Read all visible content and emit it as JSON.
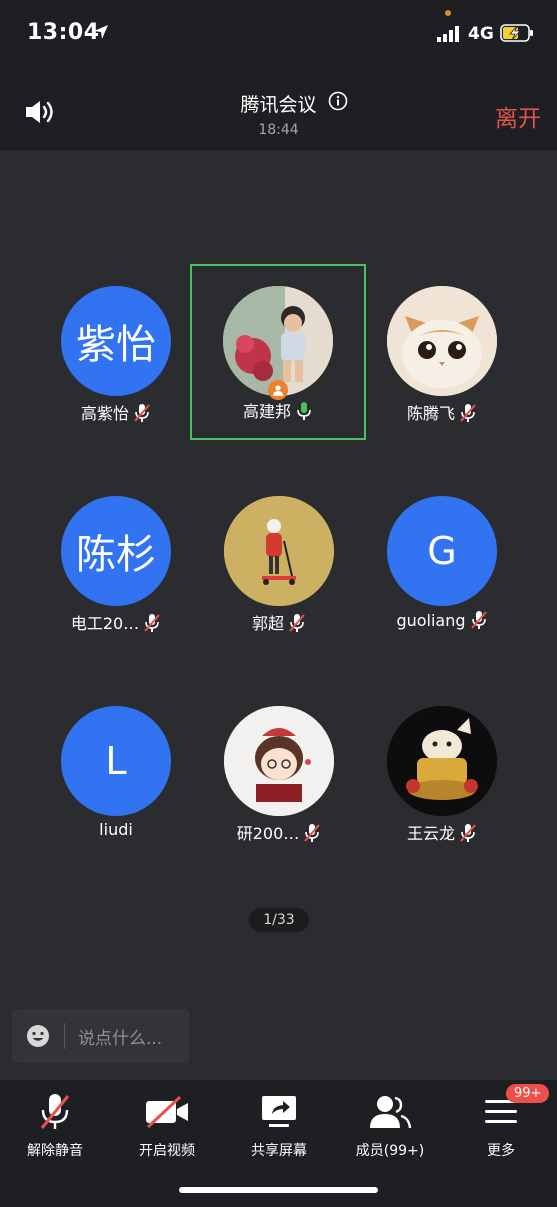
{
  "status_bar": {
    "time": "13:04",
    "network": "4G"
  },
  "header": {
    "title": "腾讯会议",
    "duration": "18:44",
    "leave_label": "离开"
  },
  "participants": [
    {
      "avatar_text": "紫怡",
      "name": "高紫怡",
      "mic": "muted"
    },
    {
      "avatar_text": "",
      "name": "高建邦",
      "mic": "active",
      "host": true,
      "avatar_image": "child-photo"
    },
    {
      "avatar_text": "",
      "name": "陈腾飞",
      "mic": "muted",
      "avatar_image": "cat-photo"
    },
    {
      "avatar_text": "陈杉",
      "name": "电工20…",
      "mic": "muted"
    },
    {
      "avatar_text": "",
      "name": "郭超",
      "mic": "muted",
      "avatar_image": "scooter-kid-photo"
    },
    {
      "avatar_text": "G",
      "name": "guoliang",
      "mic": "muted"
    },
    {
      "avatar_text": "L",
      "name": "liudi",
      "mic": "none"
    },
    {
      "avatar_text": "",
      "name": "研200…",
      "mic": "muted",
      "avatar_image": "cartoon-girl"
    },
    {
      "avatar_text": "",
      "name": "王云龙",
      "mic": "muted",
      "avatar_image": "lucky-cat"
    }
  ],
  "page_indicator": "1/33",
  "chat": {
    "placeholder": "说点什么..."
  },
  "toolbar": {
    "unmute": "解除静音",
    "start_video": "开启视频",
    "share_screen": "共享屏幕",
    "members": "成员(99+)",
    "more": "更多",
    "more_badge": "99+"
  },
  "colors": {
    "accent_blue": "#3273f2",
    "leave_red": "#e8514e",
    "active_green": "#4cbf64",
    "badge_red": "#ef4f4c"
  }
}
